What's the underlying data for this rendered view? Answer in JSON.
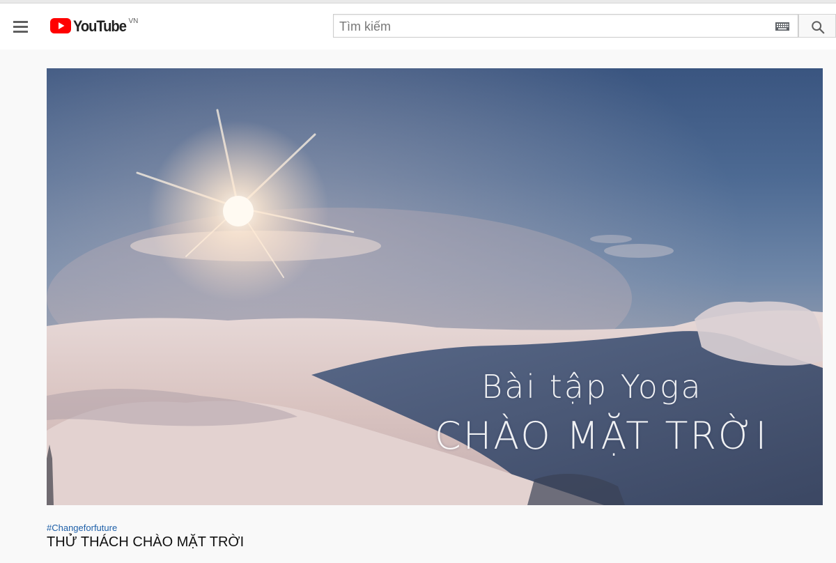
{
  "header": {
    "logo_text": "YouTube",
    "country_code": "VN",
    "search_placeholder": "Tìm kiếm",
    "icons": {
      "menu": "hamburger-menu-icon",
      "keyboard": "keyboard-icon",
      "search": "search-icon"
    }
  },
  "video": {
    "overlay_line1": "Bài tập Yoga",
    "overlay_line2": "CHÀO MẶT TRỜI"
  },
  "meta": {
    "hashtag": "#Changeforfuture",
    "title": "THỬ THÁCH CHÀO MẶT TRỜI"
  },
  "colors": {
    "brand_red": "#ff0000",
    "hashtag_blue": "#1d5fa8",
    "background": "#f9f9f9"
  }
}
